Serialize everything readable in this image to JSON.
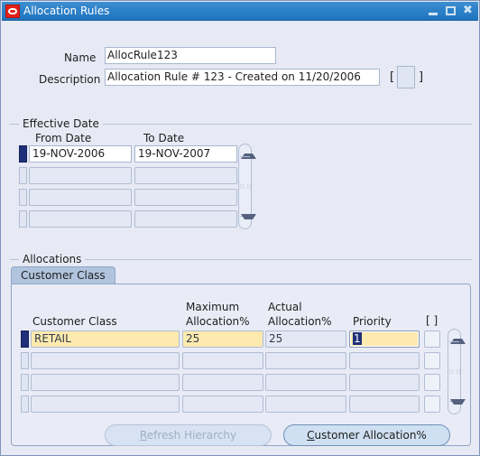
{
  "window": {
    "title": "Allocation Rules",
    "logo_icon": "oracle-logo-icon",
    "minimize_label": "",
    "maximize_label": "",
    "close_label": "✖"
  },
  "header": {
    "name_label": "Name",
    "name_value": "AllocRule123",
    "description_label": "Description",
    "description_value": "Allocation Rule # 123 - Created on 11/20/2006",
    "lov_bracket_open": "[",
    "lov_bracket_close": "]"
  },
  "effective_date": {
    "group_label": "Effective Date",
    "columns": [
      "From Date",
      "To Date"
    ],
    "rows": [
      {
        "from_date": "19-NOV-2006",
        "to_date": "19-NOV-2007",
        "current": true
      },
      {
        "from_date": "",
        "to_date": "",
        "current": false
      },
      {
        "from_date": "",
        "to_date": "",
        "current": false
      },
      {
        "from_date": "",
        "to_date": "",
        "current": false
      }
    ],
    "scrollbar": {
      "up": "up-arrow-icon",
      "down": "down-arrow-icon",
      "grip": "⁙⁙"
    }
  },
  "allocations": {
    "group_label": "Allocations",
    "tab_label": "Customer Class",
    "columns": {
      "customer_class": "Customer Class",
      "maximum_allocation_line1": "Maximum",
      "maximum_allocation_line2": "Allocation%",
      "actual_allocation_line1": "Actual",
      "actual_allocation_line2": "Allocation%",
      "priority": "Priority",
      "flex_bracket": "[ ]"
    },
    "rows": [
      {
        "customer_class": "RETAIL",
        "maximum_allocation": "25",
        "actual_allocation": "25",
        "priority": "1",
        "current": true
      },
      {
        "customer_class": "",
        "maximum_allocation": "",
        "actual_allocation": "",
        "priority": "",
        "current": false
      },
      {
        "customer_class": "",
        "maximum_allocation": "",
        "actual_allocation": "",
        "priority": "",
        "current": false
      },
      {
        "customer_class": "",
        "maximum_allocation": "",
        "actual_allocation": "",
        "priority": "",
        "current": false
      }
    ],
    "scrollbar": {
      "up": "up-arrow-icon",
      "down": "down-arrow-icon",
      "grip": "⁙⁙"
    }
  },
  "buttons": {
    "refresh_hierarchy": {
      "mnemonic": "R",
      "rest": "efresh Hierarchy",
      "enabled": false
    },
    "customer_allocation": {
      "mnemonic": "C",
      "rest": "ustomer Allocation%",
      "enabled": true
    }
  },
  "colors": {
    "form_background": "#e7eaf4",
    "title_bar": "#2b80c8",
    "entry_field": "#fdeaaf",
    "current_record": "#1f2f7a",
    "tab_active": "#b0c4de"
  }
}
